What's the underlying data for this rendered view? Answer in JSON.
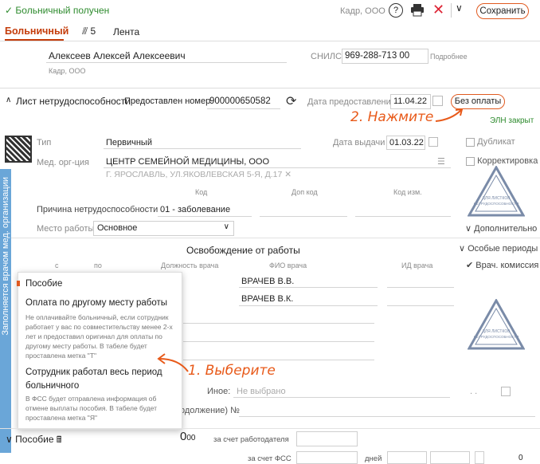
{
  "header": {
    "status": "Больничный получен",
    "org": "Кадр, ООО",
    "save_label": "Сохранить"
  },
  "tabs": {
    "main": "Больничный",
    "attachments_count": "5",
    "feed": "Лента"
  },
  "employee": {
    "name": "Алексеев Алексей Алексеевич",
    "org": "Кадр, ООО",
    "snils_label": "СНИЛС",
    "snils": "969-288-713 00",
    "more_label": "Подробнее"
  },
  "sheet": {
    "title": "Лист нетрудоспособности",
    "provided_label": "Предоставлен номер",
    "number": "900000650582",
    "date_label": "Дата предоставления",
    "date": "11.04.22",
    "no_pay_button": "Без оплаты",
    "eln_status": "ЭЛН закрыт"
  },
  "annotations": {
    "step2": "2. Нажмите",
    "step1": "1. Выберите"
  },
  "details": {
    "type_label": "Тип",
    "type_value": "Первичный",
    "issue_date_label": "Дата выдачи",
    "issue_date": "01.03.22",
    "duplicate_label": "Дубликат",
    "med_org_label": "Мед. орг-ция",
    "med_org_value": "ЦЕНТР СЕМЕЙНОЙ МЕДИЦИНЫ, ООО",
    "med_org_address": "Г. ЯРОСЛАВЛЬ, УЛ.ЯКОВЛЕВСКАЯ 5-Я, Д.17",
    "correction_label": "Корректировка",
    "code_label": "Код",
    "add_code_label": "Доп код",
    "change_code_label": "Код изм.",
    "reason_label": "Причина нетрудоспособности",
    "reason_value": "01 - заболевание",
    "workplace_label": "Место работы",
    "workplace_value": "Основное",
    "additional_label": "Дополнительно"
  },
  "sidebar": {
    "label": "Заполняется врачом мед. организации"
  },
  "release": {
    "title": "Освобождение от работы",
    "col_from": "с",
    "col_to": "по",
    "col_position": "Должность врача",
    "col_fio": "ФИО врача",
    "col_id": "ИД врача",
    "special_periods": "Особые периоды",
    "commission_label": "Врач. комиссия",
    "doctor1": "ВРАЧЕВ В.В.",
    "doctor2": "ВРАЧЕВ В.К.",
    "other_label": "Иное:",
    "other_value": "Не выбрано",
    "continued_label": "одолжение) №"
  },
  "popup": {
    "item1": "Пособие",
    "item2_title": "Оплата по другому месту работы",
    "item2_desc": "Не оплачивайте больничный, если сотрудник работает у вас по совместительству менее 2-х лет и предоставил оригинал для оплаты по другому месту работы. В табеле будет проставлена метка \"Т\"",
    "item3_title": "Сотрудник работал весь период больничного",
    "item3_desc": "В ФСС будет отправлена информация об отмене выплаты пособия. В табеле будет проставлена метка \"Я\""
  },
  "benefit": {
    "title": "Пособие",
    "amount": "0",
    "amount_cents": "00",
    "employer_label": "за счет работодателя",
    "fss_label": "за счет ФСС",
    "days_label": "дней",
    "zero": "0"
  },
  "stamps": {
    "line1": "ДЛЯ",
    "line2": "ЛИСТКОВ",
    "line3": "НЕТРУДО-",
    "line4": "СПОСОБНОСТИ"
  },
  "colors": {
    "accent": "#e05a20",
    "green": "#2e8b2e",
    "sidebar": "#6aa6d8"
  }
}
